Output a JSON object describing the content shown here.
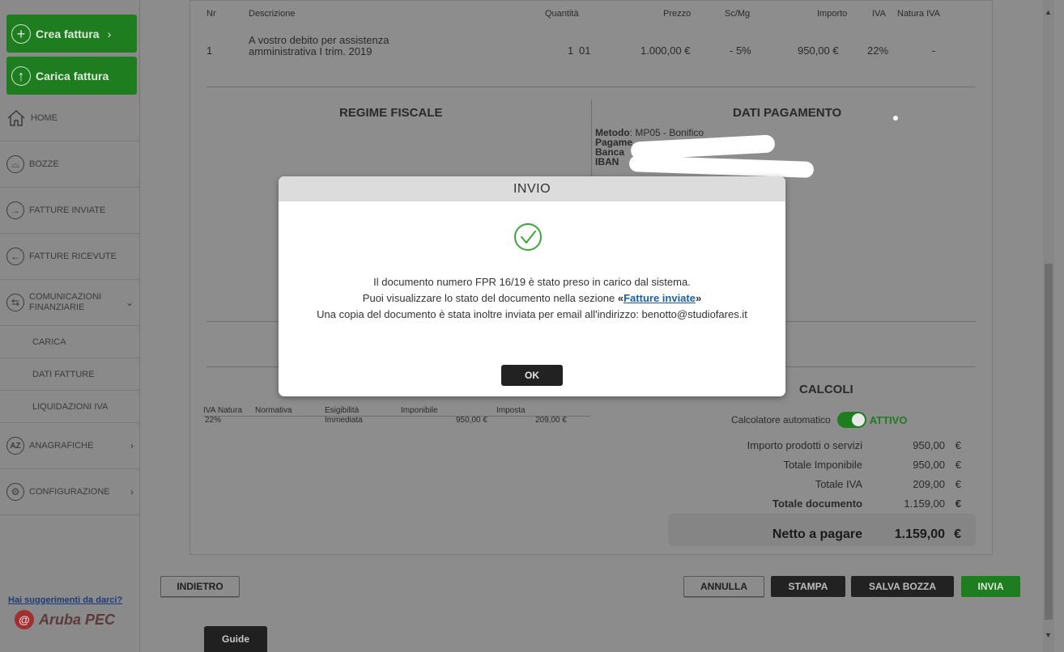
{
  "sidebar": {
    "create_invoice": "Crea fattura",
    "upload_invoice": "Carica fattura",
    "items": [
      {
        "label": "HOME"
      },
      {
        "label": "BOZZE"
      },
      {
        "label": "FATTURE INVIATE"
      },
      {
        "label": "FATTURE RICEVUTE"
      },
      {
        "label_line1": "COMUNICAZIONI",
        "label_line2": "FINANZIARIE"
      },
      {
        "label": "CARICA"
      },
      {
        "label": "DATI FATTURE"
      },
      {
        "label": "LIQUIDAZIONI IVA"
      },
      {
        "label": "ANAGRAFICHE"
      },
      {
        "label": "CONFIGURAZIONE"
      }
    ],
    "suggest": "Hai suggerimenti da darci?",
    "logo_text": "Aruba PEC"
  },
  "items_table": {
    "headers": {
      "nr": "Nr",
      "desc": "Descrizione",
      "qty": "Quantità",
      "price": "Prezzo",
      "disc": "Sc/Mg",
      "amount": "Importo",
      "vat": "IVA",
      "nature": "Natura IVA"
    },
    "row": {
      "nr": "1",
      "desc_line1": "A vostro debito per assistenza",
      "desc_line2": "amministrativa I trim. 2019",
      "qty": "1",
      "unit": "01",
      "price": "1.000,00 €",
      "disc": "- 5%",
      "amount": "950,00 €",
      "vat": "22%",
      "nature": "-"
    }
  },
  "sections": {
    "tax_regime": "REGIME FISCALE",
    "payment": "DATI PAGAMENTO",
    "calcoli": "CALCOLI"
  },
  "payment": {
    "method_label": "Metodo",
    "method_value": ": MP05 - Bonifico",
    "payment_label": "Pagame",
    "bank_label": "Banca",
    "iban_label": "IBAN"
  },
  "vat_summary": {
    "headers": {
      "vat": "IVA",
      "nature": "Natura",
      "rule": "Normativa",
      "eligibility": "Esigibilità",
      "taxable": "Imponibile",
      "tax": "Imposta"
    },
    "row": {
      "vat": "22%",
      "eligibility": "Immediata",
      "taxable": "950,00 €",
      "tax": "209,00 €"
    }
  },
  "calc": {
    "auto_label": "Calcolatore automatico",
    "auto_status": "ATTIVO",
    "rows": [
      {
        "label": "Importo prodotti o servizi",
        "value": "950,00",
        "cur": "€"
      },
      {
        "label": "Totale Imponibile",
        "value": "950,00",
        "cur": "€"
      },
      {
        "label": "Totale IVA",
        "value": "209,00",
        "cur": "€"
      },
      {
        "label": "Totale documento",
        "value": "1.159,00",
        "cur": "€"
      }
    ],
    "net_label": "Netto a pagare",
    "net_value": "1.159,00",
    "net_cur": "€"
  },
  "buttons": {
    "back": "INDIETRO",
    "cancel": "ANNULLA",
    "print": "STAMPA",
    "save_draft": "SALVA BOZZA",
    "send": "INVIA",
    "guide": "Guide"
  },
  "modal": {
    "title": "INVIO",
    "line1": "Il documento numero FPR 16/19 è stato preso in carico dal sistema.",
    "line2_pre": "Puoi visualizzare lo stato del documento nella sezione ",
    "line2_quote_open": "«",
    "line2_link": "Fatture inviate",
    "line2_quote_close": "»",
    "line3": "Una copia del documento è stata inoltre inviata per email all'indirizzo: benotto@studiofares.it",
    "ok": "OK"
  },
  "colors": {
    "brand_green": "#1e7d1e",
    "link_blue": "#1a5fa8",
    "check_green": "#3aa63a",
    "overlay_gray": "#8c8c8c"
  }
}
